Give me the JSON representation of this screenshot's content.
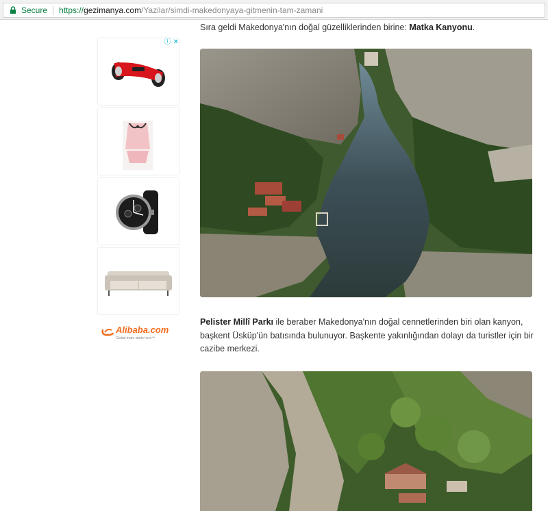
{
  "browser": {
    "secure_label": "Secure",
    "url_scheme": "https://",
    "url_host": "gezimanya.com",
    "url_path": "/Yazilar/simdi-makedonyaya-gitmenin-tam-zamani"
  },
  "ads": {
    "badge_info": "ⓘ",
    "badge_close": "✕",
    "items": [
      {
        "product": "hoverboard",
        "color": "#d8141c"
      },
      {
        "product": "pink-lingerie",
        "color": "#f2c3c6"
      },
      {
        "product": "wristwatch",
        "color": "#222222"
      },
      {
        "product": "sofa",
        "color": "#d9d2c8"
      }
    ],
    "brand_text": "Alibaba.com",
    "brand_tagline": "Global trade starts here™"
  },
  "article": {
    "lead_text": "Sıra geldi Makedonya'nın doğal güzelliklerinden birine: ",
    "lead_bold": "Matka Kanyonu",
    "lead_end": ".",
    "body_bold": "Pelister Millî Parkı",
    "body_text": " ile beraber Makedonya'nın doğal cennetlerinden biri olan kanyon, başkent Üsküp'ün batısında bulunuyor. Başkente yakınlığından dolayı da turistler için bir cazibe merkezi."
  },
  "colors": {
    "secure_green": "#0b8043",
    "ad_blue": "#00aecd",
    "alibaba_orange": "#f26b1d"
  }
}
